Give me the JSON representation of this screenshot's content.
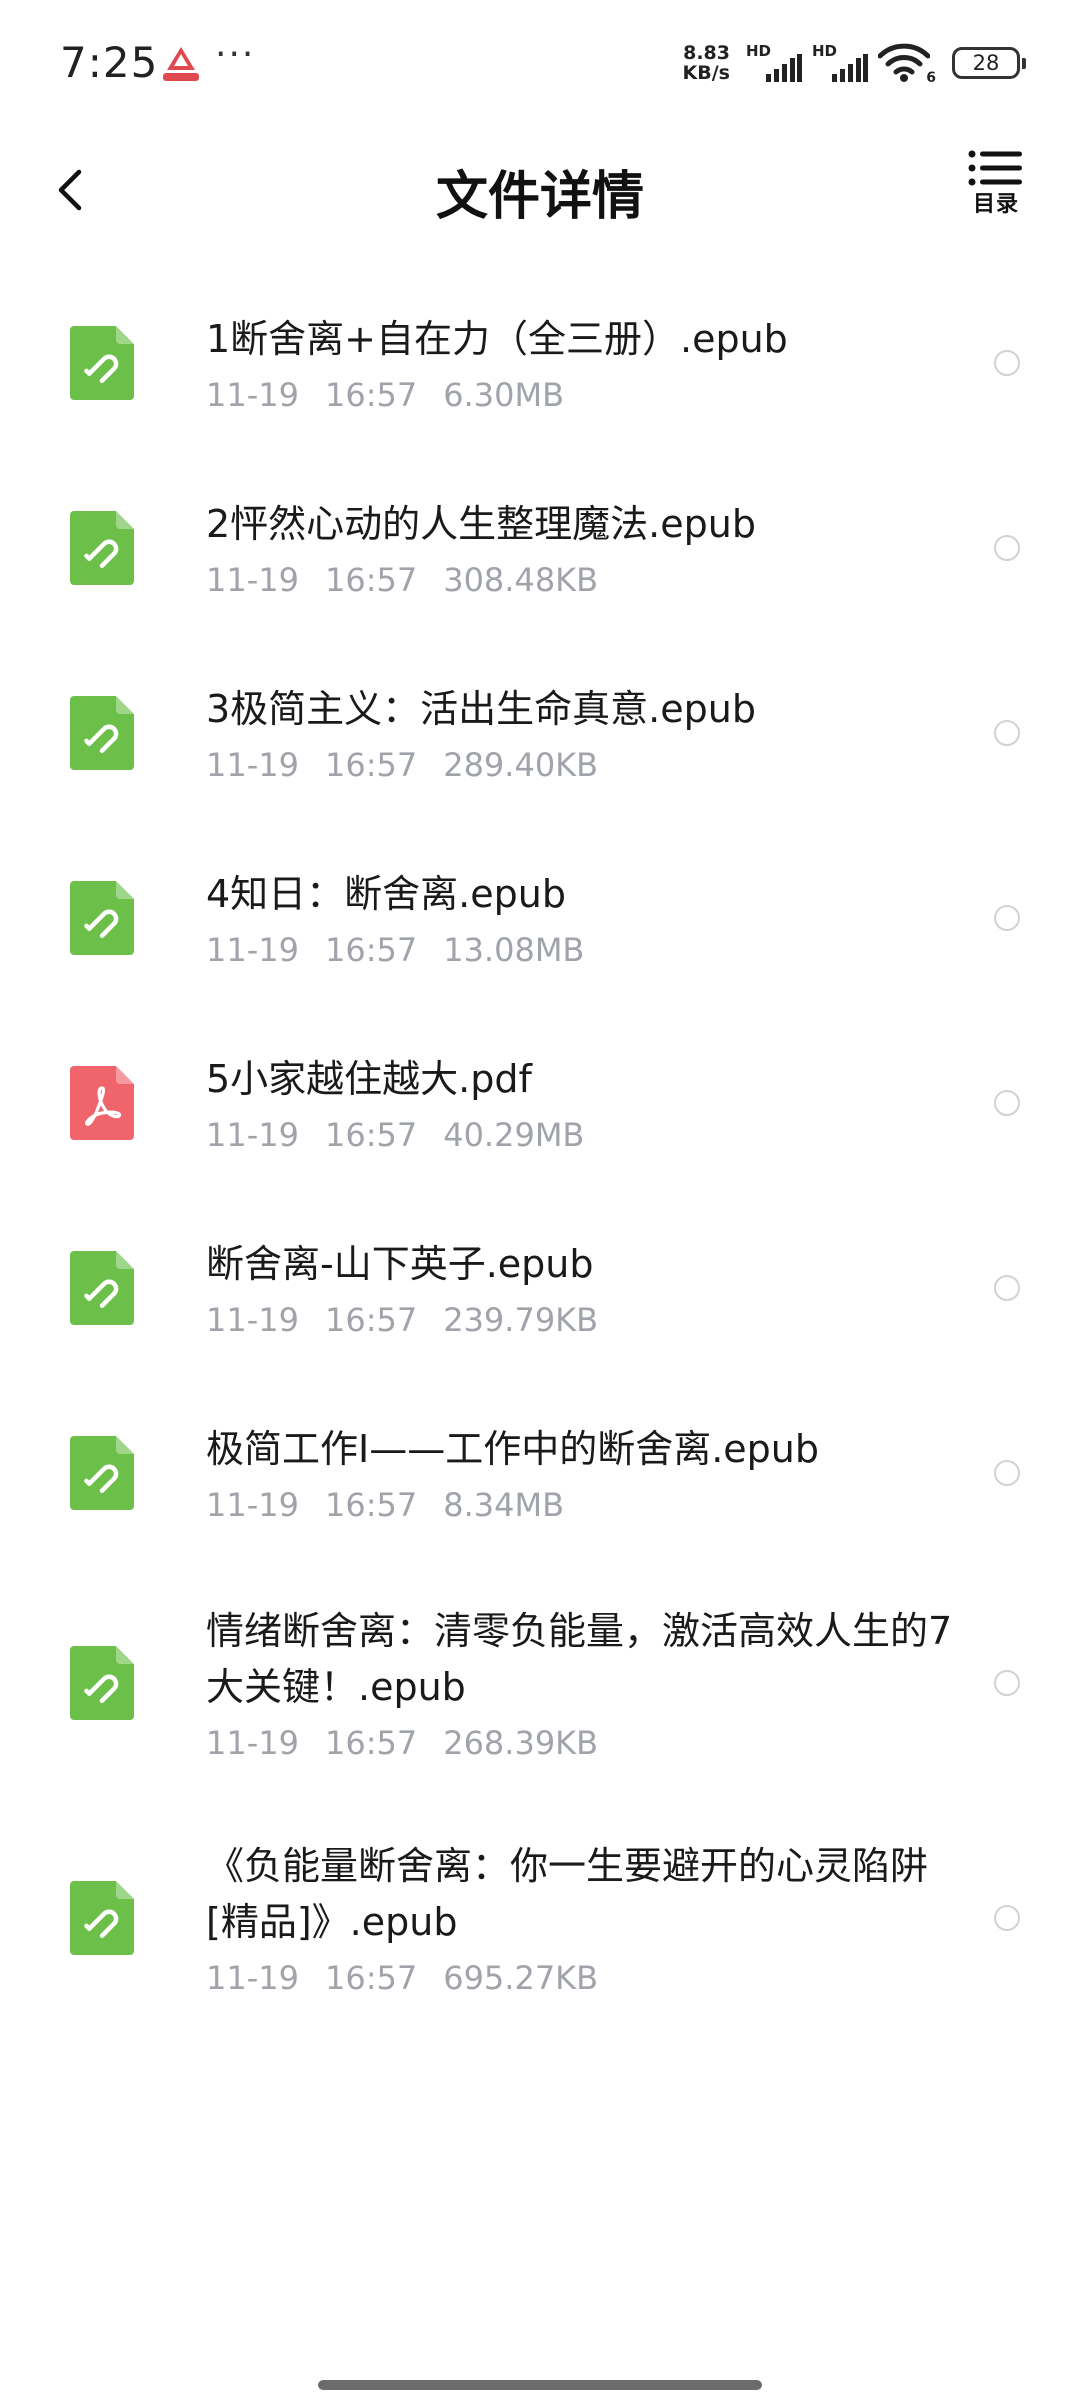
{
  "status_bar": {
    "time": "7:25",
    "more": "···",
    "net_speed_value": "8.83",
    "net_speed_unit": "KB/s",
    "hd_label_1": "HD",
    "hd_label_2": "HD",
    "wifi_badge": "6",
    "battery": "28"
  },
  "header": {
    "title": "文件详情",
    "toc_label": "目录"
  },
  "files": [
    {
      "name": "1断舍离+自在力（全三册）.epub",
      "date": "11-19",
      "time": "16:57",
      "size": "6.30MB",
      "type": "epub"
    },
    {
      "name": "2怦然心动的人生整理魔法.epub",
      "date": "11-19",
      "time": "16:57",
      "size": "308.48KB",
      "type": "epub"
    },
    {
      "name": "3极简主义：活出生命真意.epub",
      "date": "11-19",
      "time": "16:57",
      "size": "289.40KB",
      "type": "epub"
    },
    {
      "name": "4知日：断舍离.epub",
      "date": "11-19",
      "time": "16:57",
      "size": "13.08MB",
      "type": "epub"
    },
    {
      "name": "5小家越住越大.pdf",
      "date": "11-19",
      "time": "16:57",
      "size": "40.29MB",
      "type": "pdf"
    },
    {
      "name": "断舍离-山下英子.epub",
      "date": "11-19",
      "time": "16:57",
      "size": "239.79KB",
      "type": "epub"
    },
    {
      "name": "极简工作Ⅰ——工作中的断舍离.epub",
      "date": "11-19",
      "time": "16:57",
      "size": "8.34MB",
      "type": "epub"
    },
    {
      "name": "情绪断舍离：清零负能量，激活高效人生的7大关键！.epub",
      "date": "11-19",
      "time": "16:57",
      "size": "268.39KB",
      "type": "epub"
    },
    {
      "name": "《负能量断舍离：你一生要避开的心灵陷阱[精品]》.epub",
      "date": "11-19",
      "time": "16:57",
      "size": "695.27KB",
      "type": "epub"
    }
  ],
  "colors": {
    "epub_icon": "#6cc04a",
    "pdf_icon": "#f0656b",
    "meta_text": "#a0a4aa",
    "radio_border": "#cfd2d6"
  }
}
